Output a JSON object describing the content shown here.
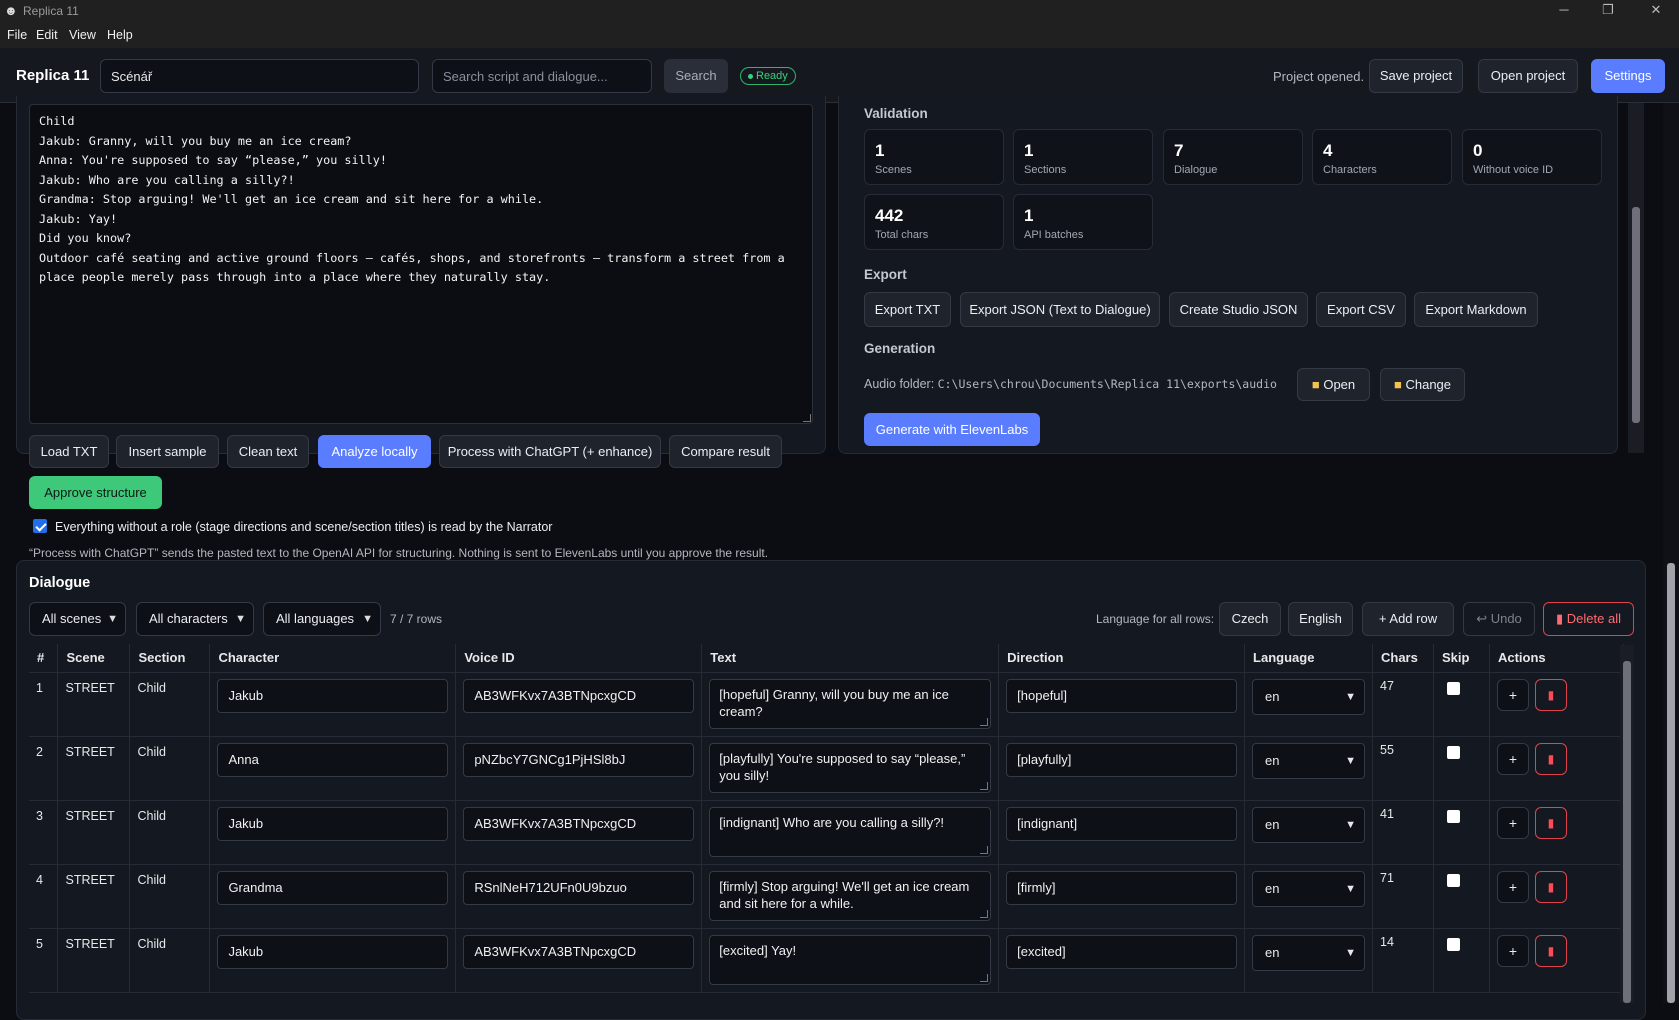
{
  "window": {
    "title": "Replica 11",
    "minimize": "─",
    "maximize": "❐",
    "close": "✕"
  },
  "menu": [
    "File",
    "Edit",
    "View",
    "Help"
  ],
  "header": {
    "brand": "Replica 11",
    "project_name": "Scénář",
    "search_placeholder": "Search script and dialogue...",
    "search_button": "Search",
    "badge": "Ready",
    "status": "Project opened.",
    "save": "Save project",
    "open": "Open project",
    "settings": "Settings"
  },
  "script": {
    "text": "Child\nJakub: Granny, will you buy me an ice cream?\nAnna: You're supposed to say “please,” you silly!\nJakub: Who are you calling a silly?!\nGrandma: Stop arguing! We'll get an ice cream and sit here for a while.\nJakub: Yay!\nDid you know?\nOutdoor café seating and active ground floors — cafés, shops, and storefronts — transform a street from a place people merely pass through into a place where they naturally stay.",
    "actions": {
      "load": "Load TXT",
      "sample": "Insert sample",
      "clean": "Clean text",
      "analyze": "Analyze locally",
      "chatgpt": "Process with ChatGPT (+ enhance)",
      "compare": "Compare result"
    },
    "approve": "Approve structure",
    "narrator_checkbox": "Everything without a role (stage directions and scene/section titles) is read by the Narrator",
    "note": "“Process with ChatGPT” sends the pasted text to the OpenAI API for structuring. Nothing is sent to ElevenLabs until you approve the result."
  },
  "validation": {
    "title": "Validation",
    "stats": [
      {
        "value": "1",
        "label": "Scenes"
      },
      {
        "value": "1",
        "label": "Sections"
      },
      {
        "value": "7",
        "label": "Dialogue"
      },
      {
        "value": "4",
        "label": "Characters"
      },
      {
        "value": "0",
        "label": "Without voice ID"
      },
      {
        "value": "442",
        "label": "Total chars"
      },
      {
        "value": "1",
        "label": "API batches"
      }
    ]
  },
  "export": {
    "title": "Export",
    "buttons": [
      "Export TXT",
      "Export JSON (Text to Dialogue)",
      "Create Studio JSON",
      "Export CSV",
      "Export Markdown"
    ]
  },
  "generation": {
    "title": "Generation",
    "audio_label": "Audio folder:",
    "audio_path": "C:\\Users\\chrou\\Documents\\Replica 11\\exports\\audio",
    "open": "Open",
    "change": "Change",
    "generate": "Generate with ElevenLabs"
  },
  "dialogue": {
    "title": "Dialogue",
    "filters": {
      "scenes": "All scenes",
      "characters": "All characters",
      "languages": "All languages"
    },
    "row_count": "7 / 7 rows",
    "lang_label": "Language for all rows:",
    "czech": "Czech",
    "english": "English",
    "add_row": "+ Add row",
    "undo": "↩ Undo",
    "delete_all": "Delete all",
    "columns": [
      "#",
      "Scene",
      "Section",
      "Character",
      "Voice ID",
      "Text",
      "Direction",
      "Language",
      "Chars",
      "Skip",
      "Actions"
    ],
    "rows": [
      {
        "n": "1",
        "scene": "STREET",
        "section": "Child",
        "character": "Jakub",
        "voice": "AB3WFKvx7A3BTNpcxgCD",
        "text": "[hopeful] Granny, will you buy me an ice cream?",
        "direction": "[hopeful]",
        "lang": "en",
        "chars": "47"
      },
      {
        "n": "2",
        "scene": "STREET",
        "section": "Child",
        "character": "Anna",
        "voice": "pNZbcY7GNCg1PjHSl8bJ",
        "text": "[playfully] You're supposed to say “please,” you silly!",
        "direction": "[playfully]",
        "lang": "en",
        "chars": "55"
      },
      {
        "n": "3",
        "scene": "STREET",
        "section": "Child",
        "character": "Jakub",
        "voice": "AB3WFKvx7A3BTNpcxgCD",
        "text": "[indignant] Who are you calling a silly?!",
        "direction": "[indignant]",
        "lang": "en",
        "chars": "41"
      },
      {
        "n": "4",
        "scene": "STREET",
        "section": "Child",
        "character": "Grandma",
        "voice": "RSnlNeH712UFn0U9bzuo",
        "text": "[firmly] Stop arguing! We'll get an ice cream and sit here for a while.",
        "direction": "[firmly]",
        "lang": "en",
        "chars": "71"
      },
      {
        "n": "5",
        "scene": "STREET",
        "section": "Child",
        "character": "Jakub",
        "voice": "AB3WFKvx7A3BTNpcxgCD",
        "text": "[excited] Yay!",
        "direction": "[excited]",
        "lang": "en",
        "chars": "14"
      }
    ],
    "plus": "+",
    "trash": "🗑"
  }
}
